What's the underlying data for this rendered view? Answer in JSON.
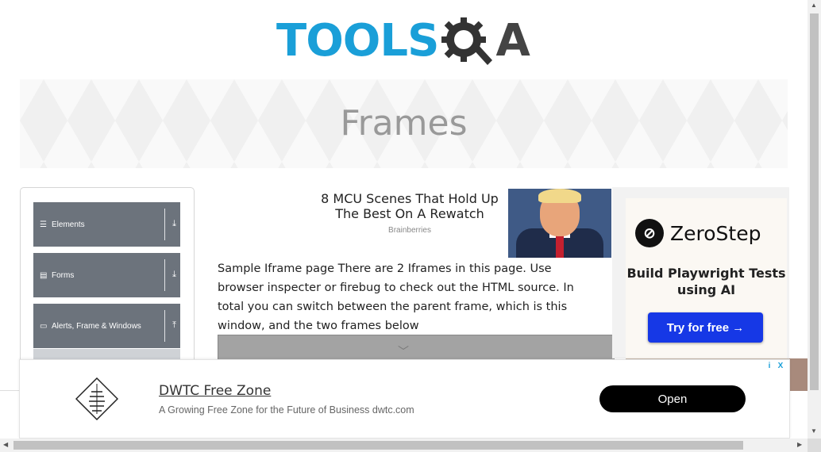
{
  "header": {
    "logo_left": "TOOLS",
    "logo_right": "A",
    "logo_icon": "gear-q-icon"
  },
  "banner": {
    "title": "Frames"
  },
  "sidebar": {
    "groups": [
      {
        "label": "Elements",
        "icon": "hamburger-icon",
        "arrow": "⤓"
      },
      {
        "label": "Forms",
        "icon": "form-icon",
        "arrow": "⤓"
      },
      {
        "label": "Alerts, Frame & Windows",
        "icon": "window-icon",
        "arrow": "⤒"
      }
    ]
  },
  "top_ad": {
    "title": "8 MCU Scenes That Hold Up The Best On A Rewatch",
    "source": "Brainberries"
  },
  "main": {
    "description": "Sample Iframe page There are 2 Iframes in this page. Use browser inspecter or firebug to check out the HTML source. In total you can switch between the parent frame, which is this window, and the two frames below"
  },
  "right_ad": {
    "brand": "ZeroStep",
    "tagline": "Build Playwright Tests using AI",
    "cta": "Try for free →"
  },
  "bottom_ad": {
    "title": "DWTC Free Zone",
    "subtitle": "A Growing Free Zone for the Future of Business dwtc.com",
    "cta": "Open",
    "info": "i",
    "close": "X"
  },
  "colors": {
    "brand_blue": "#1a9fd8",
    "sidebar_grey": "#6c737c",
    "cta_blue": "#1638e6"
  }
}
